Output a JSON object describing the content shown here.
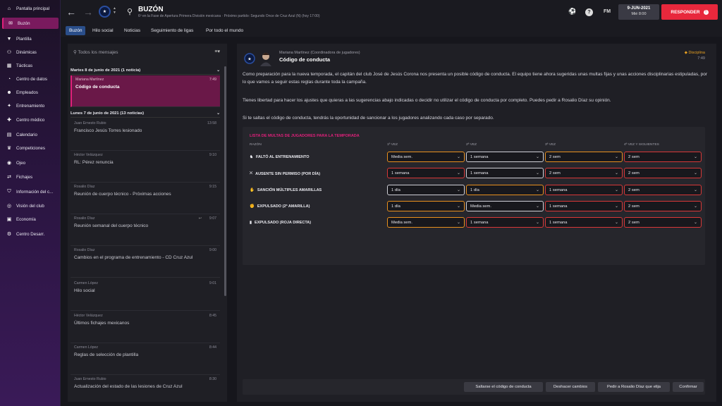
{
  "sidebar": {
    "items": [
      {
        "label": "Pantalla principal",
        "icon": "home-icon"
      },
      {
        "label": "Buzón",
        "icon": "mail-icon"
      },
      {
        "label": "Plantilla",
        "icon": "shirt-icon"
      },
      {
        "label": "Dinámicas",
        "icon": "dynamics-icon"
      },
      {
        "label": "Tácticas",
        "icon": "tactics-icon"
      },
      {
        "label": "Centro de datos",
        "icon": "data-icon"
      },
      {
        "label": "Empleados",
        "icon": "staff-icon"
      },
      {
        "label": "Entrenamiento",
        "icon": "training-icon"
      },
      {
        "label": "Centro médico",
        "icon": "medical-icon"
      },
      {
        "label": "Calendario",
        "icon": "calendar-icon"
      },
      {
        "label": "Competiciones",
        "icon": "trophy-icon"
      },
      {
        "label": "Ojeo",
        "icon": "scouting-icon"
      },
      {
        "label": "Fichajes",
        "icon": "transfers-icon"
      },
      {
        "label": "Información del c...",
        "icon": "club-info-icon"
      },
      {
        "label": "Visión del club",
        "icon": "vision-icon"
      },
      {
        "label": "Economía",
        "icon": "finance-icon"
      },
      {
        "label": "Centro Desarr.",
        "icon": "development-icon"
      }
    ]
  },
  "header": {
    "title": "BUZÓN",
    "subtitle": "6º en la Fase de Apertura Primera División mexicana · Próximo partido: Segundo Once de Cruz Azul (N) (hoy 17:00)",
    "fm_label": "FM",
    "date": "9-JUN-2021",
    "time": "Mié 8:00",
    "respond_label": "RESPONDER"
  },
  "tabs": [
    "Buzón",
    "Hilo social",
    "Noticias",
    "Seguimiento de ligas",
    "Por todo el mundo"
  ],
  "inbox": {
    "search_placeholder": "Todos los mensajes",
    "groups": [
      {
        "label": "Martes 8 de junio de 2021 (1 noticia)"
      },
      {
        "label": "Lunes 7 de junio de 2021 (13 noticias)"
      }
    ],
    "messages": [
      {
        "sender": "Mariana Martínez",
        "time": "7:49",
        "subject": "Código de conducta"
      },
      {
        "sender": "Juan Ernesto Rubio",
        "time": "13:58",
        "subject": "Francisco Jesús Torres lesionado"
      },
      {
        "sender": "Héctor Velázquez",
        "time": "9:10",
        "subject": "RL: Pérez renuncia"
      },
      {
        "sender": "Rosalio Díaz",
        "time": "9:15",
        "subject": "Reunión de cuerpo técnico - Próximas acciones"
      },
      {
        "sender": "Rosalio Díaz",
        "time": "9:07",
        "subject": "Reunión semanal del cuerpo técnico"
      },
      {
        "sender": "Rosalio Díaz",
        "time": "9:00",
        "subject": "Cambios en el programa de entrenamiento - CD Cruz Azul"
      },
      {
        "sender": "Carmen López",
        "time": "9:01",
        "subject": "Hilo social"
      },
      {
        "sender": "Héctor Velázquez",
        "time": "8:45",
        "subject": "Últimos fichajes mexicanos"
      },
      {
        "sender": "Carmen López",
        "time": "8:44",
        "subject": "Reglas de selección de plantilla"
      },
      {
        "sender": "Juan Ernesto Rubio",
        "time": "8:30",
        "subject": "Actualización del estado de las lesiones de Cruz Azul"
      }
    ]
  },
  "message": {
    "from": "Mariana Martínez  (Coordinadora de jugadores)",
    "subject": "Código de conducta",
    "category": "Disciplina",
    "time": "7:49",
    "paragraphs": [
      "Como preparación para la nueva temporada, el capitán del club José de Jesús Corona nos presenta un posible código de conducta. El equipo tiene ahora sugeridas unas multas fijas y unas acciones disciplinarias estipuladas, por lo que vamos a seguir estas reglas durante toda la campaña.",
      "Tienes libertad para hacer los ajustes que quieras a las sugerencias abajo indicadas o decidir no utilizar el código de conducta por completo. Puedes pedir a Rosalio Díaz su opinión.",
      "Si te saltas el código de conducta, tendrás la oportunidad de sancionar a los jugadores analizando cada caso por separado."
    ],
    "fines": {
      "title": "LISTA DE MULTAS DE JUGADORES PARA LA TEMPORADA",
      "columns": [
        "RAZÓN",
        "1ª VEZ",
        "2ª VEZ",
        "3ª VEZ",
        "4ª VEZ Y SIGUIENTES"
      ],
      "rows": [
        {
          "reason": "FALTÓ AL ENTRENAMIENTO",
          "icon": "missed-training-icon",
          "values": [
            "Media sem.",
            "1 semana",
            "2 sem",
            "2 sem"
          ],
          "borders": [
            "orange",
            "white",
            "orange",
            "red"
          ]
        },
        {
          "reason": "AUSENTE SIN PERMISO (POR DÍA)",
          "icon": "absent-icon",
          "values": [
            "1 semana",
            "1 semana",
            "2 sem",
            "2 sem"
          ],
          "borders": [
            "red",
            "white",
            "red",
            "red"
          ]
        },
        {
          "reason": "SANCIÓN MÚLTIPLES AMARILLAS",
          "icon": "yellow-cards-icon",
          "values": [
            "1 día",
            "1 día",
            "1 semana",
            "2 sem"
          ],
          "borders": [
            "white",
            "orange",
            "red",
            "red"
          ]
        },
        {
          "reason": "EXPULSADO (2ª AMARILLA)",
          "icon": "second-yellow-icon",
          "values": [
            "1 día",
            "Media sem.",
            "1 semana",
            "2 sem"
          ],
          "borders": [
            "orange",
            "white",
            "red",
            "red"
          ]
        },
        {
          "reason": "EXPULSADO (ROJA DIRECTA)",
          "icon": "red-card-icon",
          "values": [
            "Media sem.",
            "1 semana",
            "1 semana",
            "2 sem"
          ],
          "borders": [
            "orange",
            "red",
            "red",
            "red"
          ]
        }
      ]
    },
    "buttons": [
      "Saltarse el código de conducta",
      "Deshacer cambios",
      "Pedir a Rosalio Díaz que elija",
      "Confirmar"
    ]
  },
  "colors": {
    "accent": "#e0207a",
    "respond": "#e8283c",
    "tab_active": "#2a4e8a",
    "orange": "#e8901e",
    "red": "#d83838"
  }
}
